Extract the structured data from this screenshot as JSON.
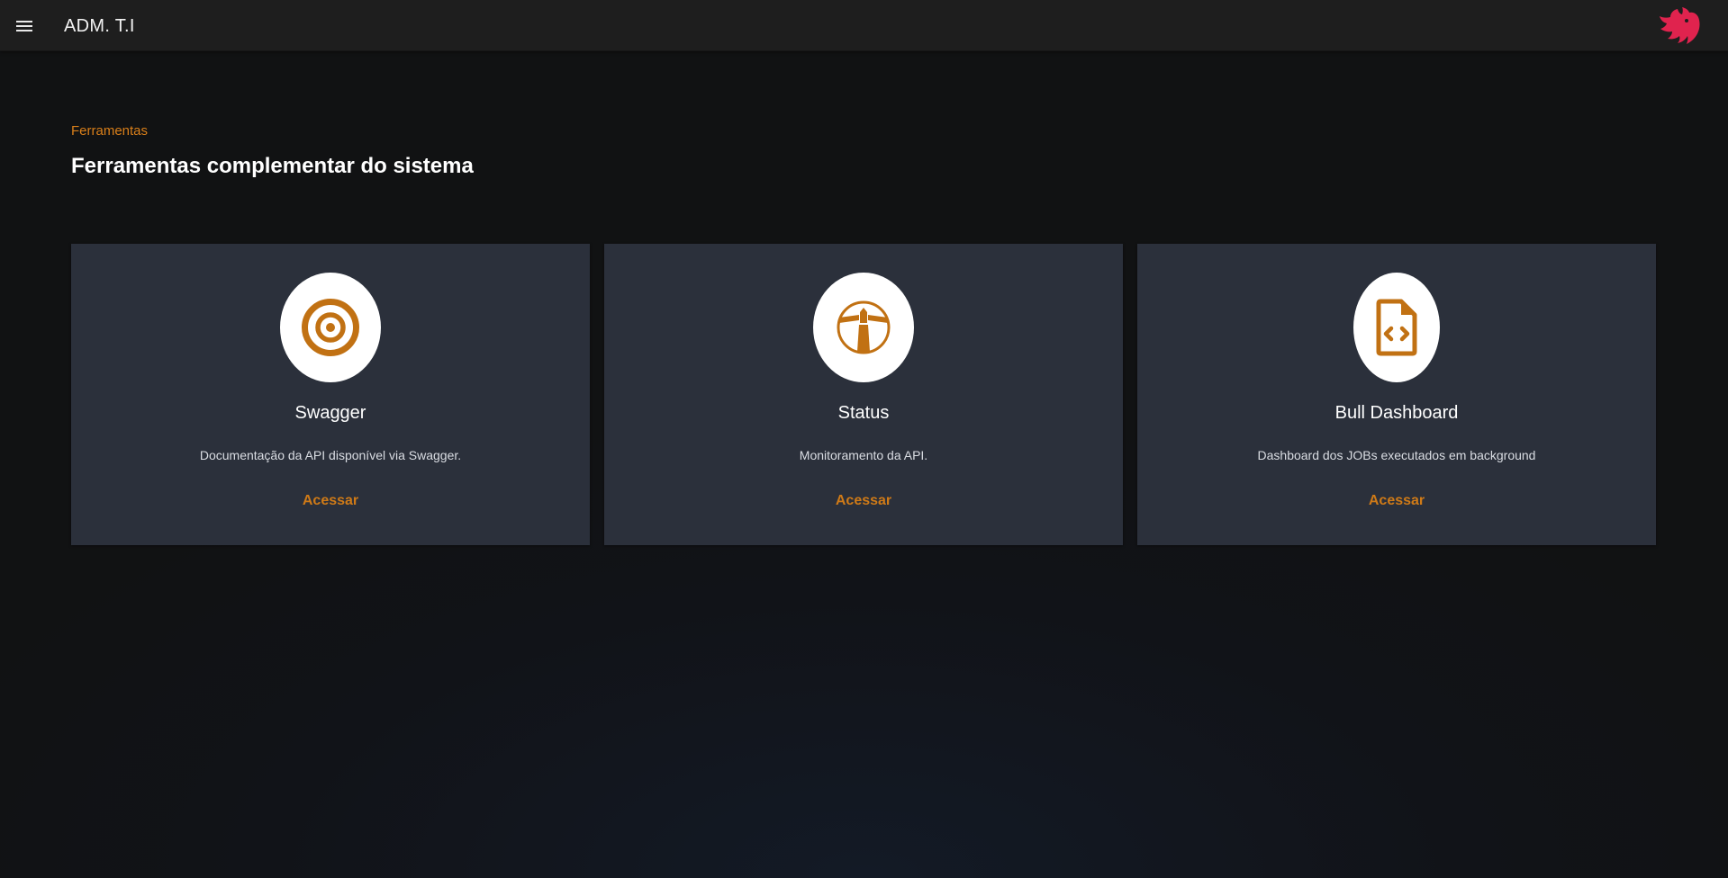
{
  "appbar": {
    "title": "ADM. T.I",
    "menu_icon": "hamburger-menu-icon",
    "logo_icon": "nestjs-cat-logo",
    "logo_color": "#e0234e"
  },
  "page": {
    "subtitle": "Ferramentas",
    "title": "Ferramentas complementar do sistema"
  },
  "colors": {
    "accent": "#cf7a17",
    "card_bg": "#2b303b",
    "appbar_bg": "#1e1e1e",
    "page_bg": "#111213"
  },
  "cards": [
    {
      "icon": "target-icon",
      "title": "Swagger",
      "description": "Documentação da API disponível via Swagger.",
      "action": "Acessar"
    },
    {
      "icon": "lighthouse-icon",
      "title": "Status",
      "description": "Monitoramento da API.",
      "action": "Acessar"
    },
    {
      "icon": "code-file-icon",
      "title": "Bull Dashboard",
      "description": "Dashboard dos JOBs executados em background",
      "action": "Acessar"
    }
  ]
}
